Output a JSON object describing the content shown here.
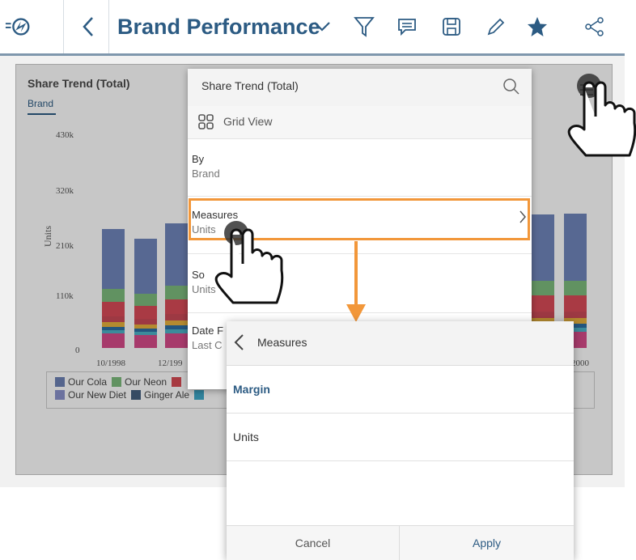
{
  "toolbar": {
    "title": "Brand Performance",
    "icons": [
      "app-menu-icon",
      "back-icon",
      "chevron-down-icon",
      "filter-icon",
      "comment-icon",
      "save-icon",
      "edit-icon",
      "favorite-icon",
      "share-icon"
    ]
  },
  "card": {
    "title": "Share Trend (Total)",
    "subtitle": "Brand"
  },
  "chart_data": {
    "type": "bar",
    "ylabel": "Units",
    "yticks": [
      "430k",
      "320k",
      "210k",
      "110k",
      "0"
    ],
    "xticks_visible": [
      "10/1998",
      "12/199",
      "2000"
    ],
    "series": [
      {
        "name": "Our Cola",
        "color": "#6e82b5"
      },
      {
        "name": "Our Neon",
        "color": "#7dbb7d"
      },
      {
        "name": "Our New Diet",
        "color": "#8b93cc"
      },
      {
        "name": "Ginger Ale",
        "color": "#44617f"
      }
    ]
  },
  "menu": {
    "title": "Share Trend (Total)",
    "grid_view": "Grid View",
    "items": [
      {
        "label": "By",
        "value": "Brand"
      },
      {
        "label": "Measures",
        "value": "Units"
      },
      {
        "label": "So",
        "value": "Units"
      },
      {
        "label": "Date F",
        "value": "Last C"
      }
    ]
  },
  "measures_panel": {
    "title": "Measures",
    "options": [
      {
        "label": "Margin",
        "selected": true
      },
      {
        "label": "Units",
        "selected": false
      }
    ],
    "cancel_label": "Cancel",
    "apply_label": "Apply"
  },
  "colors": {
    "accent": "#2c5b83",
    "highlight": "#f2973a"
  }
}
